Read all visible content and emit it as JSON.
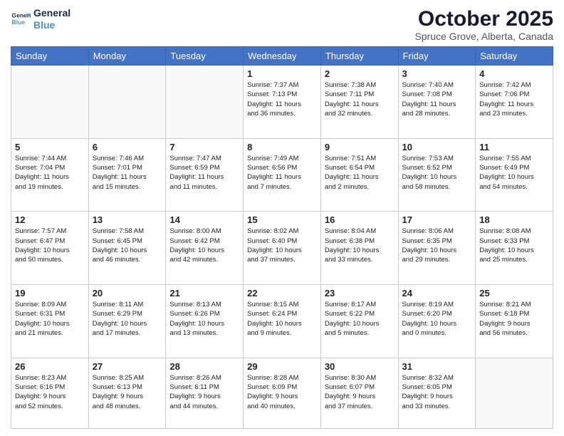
{
  "header": {
    "logo_line1": "General",
    "logo_line2": "Blue",
    "title": "October 2025",
    "subtitle": "Spruce Grove, Alberta, Canada"
  },
  "weekdays": [
    "Sunday",
    "Monday",
    "Tuesday",
    "Wednesday",
    "Thursday",
    "Friday",
    "Saturday"
  ],
  "weeks": [
    [
      {
        "day": "",
        "info": ""
      },
      {
        "day": "",
        "info": ""
      },
      {
        "day": "",
        "info": ""
      },
      {
        "day": "1",
        "info": "Sunrise: 7:37 AM\nSunset: 7:13 PM\nDaylight: 11 hours\nand 36 minutes."
      },
      {
        "day": "2",
        "info": "Sunrise: 7:38 AM\nSunset: 7:11 PM\nDaylight: 11 hours\nand 32 minutes."
      },
      {
        "day": "3",
        "info": "Sunrise: 7:40 AM\nSunset: 7:08 PM\nDaylight: 11 hours\nand 28 minutes."
      },
      {
        "day": "4",
        "info": "Sunrise: 7:42 AM\nSunset: 7:06 PM\nDaylight: 11 hours\nand 23 minutes."
      }
    ],
    [
      {
        "day": "5",
        "info": "Sunrise: 7:44 AM\nSunset: 7:04 PM\nDaylight: 11 hours\nand 19 minutes."
      },
      {
        "day": "6",
        "info": "Sunrise: 7:46 AM\nSunset: 7:01 PM\nDaylight: 11 hours\nand 15 minutes."
      },
      {
        "day": "7",
        "info": "Sunrise: 7:47 AM\nSunset: 6:59 PM\nDaylight: 11 hours\nand 11 minutes."
      },
      {
        "day": "8",
        "info": "Sunrise: 7:49 AM\nSunset: 6:56 PM\nDaylight: 11 hours\nand 7 minutes."
      },
      {
        "day": "9",
        "info": "Sunrise: 7:51 AM\nSunset: 6:54 PM\nDaylight: 11 hours\nand 2 minutes."
      },
      {
        "day": "10",
        "info": "Sunrise: 7:53 AM\nSunset: 6:52 PM\nDaylight: 10 hours\nand 58 minutes."
      },
      {
        "day": "11",
        "info": "Sunrise: 7:55 AM\nSunset: 6:49 PM\nDaylight: 10 hours\nand 54 minutes."
      }
    ],
    [
      {
        "day": "12",
        "info": "Sunrise: 7:57 AM\nSunset: 6:47 PM\nDaylight: 10 hours\nand 50 minutes."
      },
      {
        "day": "13",
        "info": "Sunrise: 7:58 AM\nSunset: 6:45 PM\nDaylight: 10 hours\nand 46 minutes."
      },
      {
        "day": "14",
        "info": "Sunrise: 8:00 AM\nSunset: 6:42 PM\nDaylight: 10 hours\nand 42 minutes."
      },
      {
        "day": "15",
        "info": "Sunrise: 8:02 AM\nSunset: 6:40 PM\nDaylight: 10 hours\nand 37 minutes."
      },
      {
        "day": "16",
        "info": "Sunrise: 8:04 AM\nSunset: 6:38 PM\nDaylight: 10 hours\nand 33 minutes."
      },
      {
        "day": "17",
        "info": "Sunrise: 8:06 AM\nSunset: 6:35 PM\nDaylight: 10 hours\nand 29 minutes."
      },
      {
        "day": "18",
        "info": "Sunrise: 8:08 AM\nSunset: 6:33 PM\nDaylight: 10 hours\nand 25 minutes."
      }
    ],
    [
      {
        "day": "19",
        "info": "Sunrise: 8:09 AM\nSunset: 6:31 PM\nDaylight: 10 hours\nand 21 minutes."
      },
      {
        "day": "20",
        "info": "Sunrise: 8:11 AM\nSunset: 6:29 PM\nDaylight: 10 hours\nand 17 minutes."
      },
      {
        "day": "21",
        "info": "Sunrise: 8:13 AM\nSunset: 6:26 PM\nDaylight: 10 hours\nand 13 minutes."
      },
      {
        "day": "22",
        "info": "Sunrise: 8:15 AM\nSunset: 6:24 PM\nDaylight: 10 hours\nand 9 minutes."
      },
      {
        "day": "23",
        "info": "Sunrise: 8:17 AM\nSunset: 6:22 PM\nDaylight: 10 hours\nand 5 minutes."
      },
      {
        "day": "24",
        "info": "Sunrise: 8:19 AM\nSunset: 6:20 PM\nDaylight: 10 hours\nand 0 minutes."
      },
      {
        "day": "25",
        "info": "Sunrise: 8:21 AM\nSunset: 6:18 PM\nDaylight: 9 hours\nand 56 minutes."
      }
    ],
    [
      {
        "day": "26",
        "info": "Sunrise: 8:23 AM\nSunset: 6:16 PM\nDaylight: 9 hours\nand 52 minutes."
      },
      {
        "day": "27",
        "info": "Sunrise: 8:25 AM\nSunset: 6:13 PM\nDaylight: 9 hours\nand 48 minutes."
      },
      {
        "day": "28",
        "info": "Sunrise: 8:26 AM\nSunset: 6:11 PM\nDaylight: 9 hours\nand 44 minutes."
      },
      {
        "day": "29",
        "info": "Sunrise: 8:28 AM\nSunset: 6:09 PM\nDaylight: 9 hours\nand 40 minutes."
      },
      {
        "day": "30",
        "info": "Sunrise: 8:30 AM\nSunset: 6:07 PM\nDaylight: 9 hours\nand 37 minutes."
      },
      {
        "day": "31",
        "info": "Sunrise: 8:32 AM\nSunset: 6:05 PM\nDaylight: 9 hours\nand 33 minutes."
      },
      {
        "day": "",
        "info": ""
      }
    ]
  ]
}
